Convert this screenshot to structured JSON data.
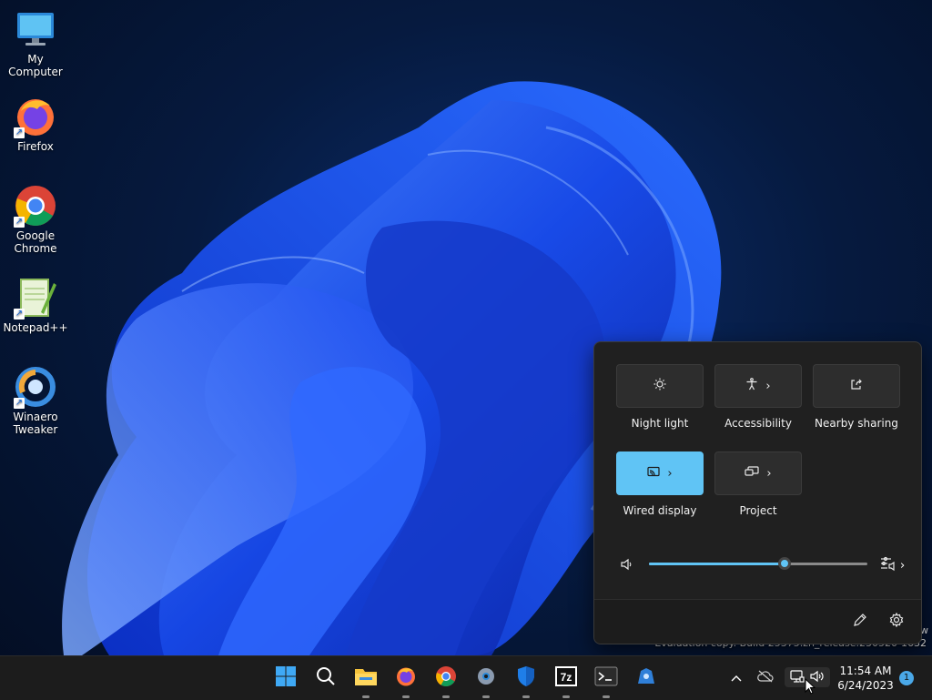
{
  "desktop": {
    "icons": [
      {
        "label": "My Computer",
        "icon": "monitor-icon"
      },
      {
        "label": "Firefox",
        "icon": "firefox-icon"
      },
      {
        "label": "Google Chrome",
        "icon": "chrome-icon"
      },
      {
        "label": "Notepad++",
        "icon": "notepadpp-icon"
      },
      {
        "label": "Winaero Tweaker",
        "icon": "winaero-tweaker-icon"
      }
    ]
  },
  "watermark": {
    "line": "Evaluation copy. Build 25375.zn_release.230520-1632",
    "extra": "w"
  },
  "quick_settings": {
    "tiles": [
      {
        "label": "Night light",
        "icon": "night-light-icon",
        "active": false,
        "has_chevron": false
      },
      {
        "label": "Accessibility",
        "icon": "accessibility-icon",
        "active": false,
        "has_chevron": true
      },
      {
        "label": "Nearby sharing",
        "icon": "share-icon",
        "active": false,
        "has_chevron": false
      },
      {
        "label": "Wired display",
        "icon": "cast-icon",
        "active": true,
        "has_chevron": true
      },
      {
        "label": "Project",
        "icon": "project-icon",
        "active": false,
        "has_chevron": true
      }
    ],
    "volume": {
      "level_percent": 62,
      "icon": "speaker-icon",
      "mixer_icon": "audio-mixer-icon"
    },
    "footer": {
      "edit_icon": "pencil-icon",
      "settings_icon": "gear-icon"
    },
    "accent": "#60c4f5"
  },
  "taskbar": {
    "apps": [
      "start-icon",
      "search-icon",
      "file-explorer-icon",
      "firefox-icon",
      "chrome-icon",
      "settings-app-icon",
      "windows-security-icon",
      "7zip-icon",
      "terminal-icon",
      "winaero-tweaker-icon"
    ],
    "tray": [
      "chevron-up-icon",
      "cloud-icon",
      "network-icon",
      "volume-icon"
    ],
    "clock": {
      "time": "11:54 AM",
      "date": "6/24/2023"
    },
    "notification_count": "1"
  }
}
